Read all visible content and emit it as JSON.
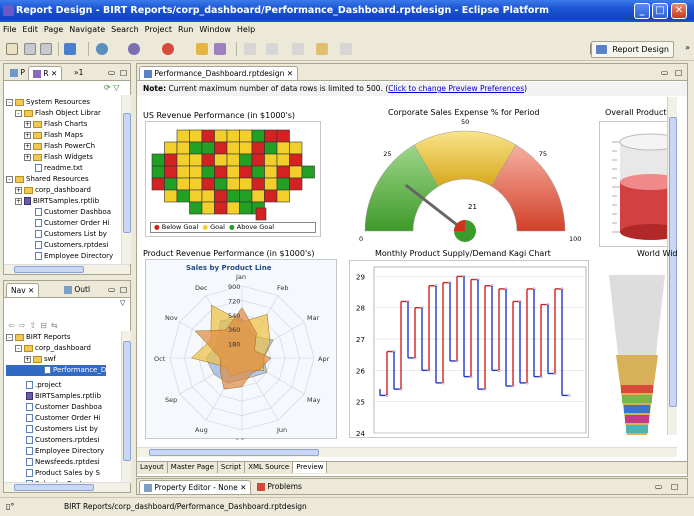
{
  "window": {
    "title": "Report Design - BIRT Reports/corp_dashboard/Performance_Dashboard.rptdesign - Eclipse Platform"
  },
  "menu": [
    "File",
    "Edit",
    "Page",
    "Navigate",
    "Search",
    "Project",
    "Run",
    "Window",
    "Help"
  ],
  "toolbar": {
    "perspective": "Report Design"
  },
  "left_top": {
    "tabs": [
      "P",
      "R",
      "»1"
    ],
    "items": [
      {
        "label": "System Resources",
        "level": 0,
        "kind": "folder",
        "exp": "-"
      },
      {
        "label": "Flash Object Librar",
        "level": 1,
        "kind": "folder",
        "exp": "-"
      },
      {
        "label": "Flash Charts",
        "level": 2,
        "kind": "folder",
        "exp": "+"
      },
      {
        "label": "Flash Maps",
        "level": 2,
        "kind": "folder",
        "exp": "+"
      },
      {
        "label": "Flash PowerCh",
        "level": 2,
        "kind": "folder",
        "exp": "+"
      },
      {
        "label": "Flash Widgets",
        "level": 2,
        "kind": "folder",
        "exp": "+"
      },
      {
        "label": "readme.txt",
        "level": 2,
        "kind": "file",
        "exp": ""
      },
      {
        "label": "Shared Resources",
        "level": 0,
        "kind": "folder",
        "exp": "-"
      },
      {
        "label": "corp_dashboard",
        "level": 1,
        "kind": "folder",
        "exp": "+"
      },
      {
        "label": "BIRTSamples.rptlib",
        "level": 1,
        "kind": "lib",
        "exp": "+"
      },
      {
        "label": "Customer Dashboa",
        "level": 2,
        "kind": "file",
        "exp": ""
      },
      {
        "label": "Customer Order Hi",
        "level": 2,
        "kind": "file",
        "exp": ""
      },
      {
        "label": "Customers List by",
        "level": 2,
        "kind": "file",
        "exp": ""
      },
      {
        "label": "Customers.rptdesi",
        "level": 2,
        "kind": "file",
        "exp": ""
      },
      {
        "label": "Employee Directory",
        "level": 2,
        "kind": "file",
        "exp": ""
      }
    ]
  },
  "left_bottom": {
    "tabs": [
      "Nav",
      "Outl"
    ],
    "items": [
      {
        "label": "BIRT Reports",
        "level": 0,
        "kind": "folder",
        "exp": "-"
      },
      {
        "label": "corp_dashboard",
        "level": 1,
        "kind": "folder",
        "exp": "-"
      },
      {
        "label": "swf",
        "level": 2,
        "kind": "folder",
        "exp": "+"
      },
      {
        "label": "Performance_D",
        "level": 3,
        "kind": "file",
        "exp": "",
        "selected": true
      },
      {
        "label": ".project",
        "level": 1,
        "kind": "file",
        "exp": ""
      },
      {
        "label": "BIRTSamples.rptlib",
        "level": 1,
        "kind": "lib",
        "exp": ""
      },
      {
        "label": "Customer Dashboa",
        "level": 1,
        "kind": "file",
        "exp": ""
      },
      {
        "label": "Customer Order Hi",
        "level": 1,
        "kind": "file",
        "exp": ""
      },
      {
        "label": "Customers List by",
        "level": 1,
        "kind": "file",
        "exp": ""
      },
      {
        "label": "Customers.rptdesi",
        "level": 1,
        "kind": "file",
        "exp": ""
      },
      {
        "label": "Employee Directory",
        "level": 1,
        "kind": "file",
        "exp": ""
      },
      {
        "label": "Newsfeeds.rptdesi",
        "level": 1,
        "kind": "file",
        "exp": ""
      },
      {
        "label": "Product Sales by S",
        "level": 1,
        "kind": "file",
        "exp": ""
      },
      {
        "label": "Sales by Customer",
        "level": 1,
        "kind": "file",
        "exp": ""
      }
    ]
  },
  "editor": {
    "tab": "Performance_Dashboard.rptdesign",
    "note_bold": "Note:",
    "note_text": " Current maximum number of data rows is limited to 500. (",
    "note_link": "Click to change Preview Preferences",
    "note_end": ")",
    "bottom_tabs": [
      "Layout",
      "Master Page",
      "Script",
      "XML Source",
      "Preview"
    ]
  },
  "charts": {
    "us_map": {
      "title": "US Revenue Performance (in $1000's)",
      "legend": [
        "Below Goal",
        "Goal",
        "Above Goal"
      ],
      "colors": [
        "#d42121",
        "#f2cf2a",
        "#22a024"
      ]
    },
    "gauge": {
      "title": "Corporate Sales Expense % for Period",
      "ticks": [
        "0",
        "25",
        "50",
        "75",
        "100"
      ],
      "value_label": "21",
      "value": 21
    },
    "cylinder": {
      "title": "Overall Product"
    },
    "radar": {
      "title": "Product Revenue Performance (in $1000's)",
      "subtitle": "Sales by Product Line",
      "months": [
        "Jan",
        "Feb",
        "Mar",
        "Apr",
        "May",
        "Jun",
        "Jul",
        "Aug",
        "Sep",
        "Oct",
        "Nov",
        "Dec"
      ],
      "rings": [
        "900",
        "720",
        "540",
        "360",
        "180"
      ]
    },
    "kagi": {
      "title": "Monthly Product Supply/Demand Kagi Chart",
      "y_ticks": [
        "29",
        "28",
        "27",
        "26",
        "25",
        "24"
      ],
      "ylim": [
        24,
        29.3
      ]
    },
    "funnel": {
      "title": "World Wid"
    }
  },
  "bottom_panel": {
    "tabs": [
      "Property Editor - None",
      "Problems"
    ]
  },
  "status": {
    "text": "BIRT Reports/corp_dashboard/Performance_Dashboard.rptdesign"
  }
}
